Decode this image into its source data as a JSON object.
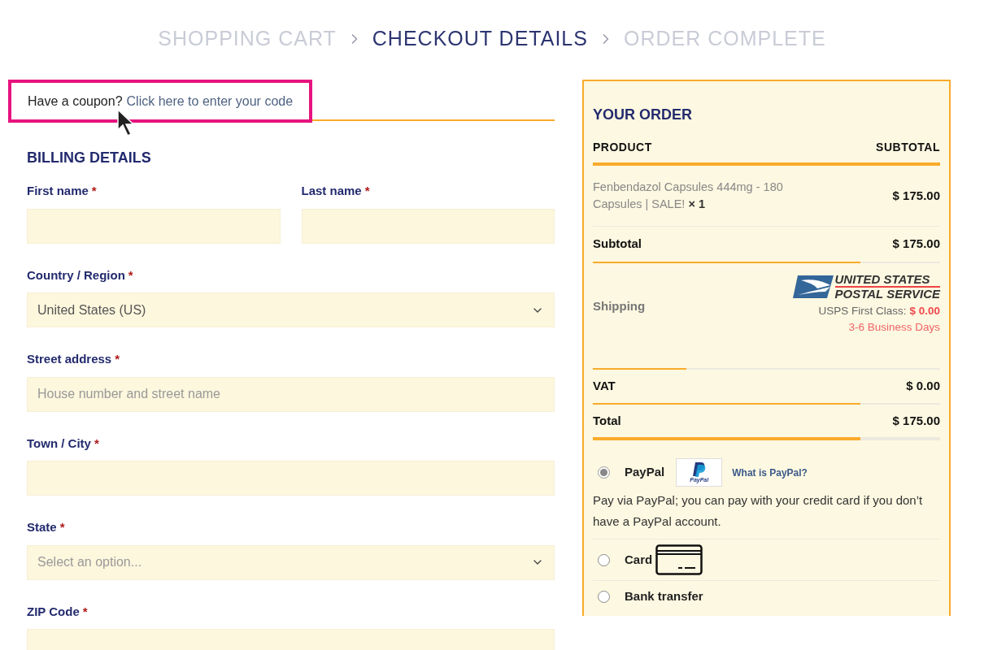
{
  "breadcrumb": [
    {
      "label": "SHOPPING CART",
      "selected": false
    },
    {
      "label": "CHECKOUT DETAILS",
      "selected": true
    },
    {
      "label": "ORDER COMPLETE",
      "selected": false
    }
  ],
  "coupon": {
    "prompt": "Have a coupon?",
    "link": "Click here to enter your code",
    "highlighted": true
  },
  "billing": {
    "title": "BILLING DETAILS",
    "rows": [
      [
        {
          "label": "First name",
          "required_mark": "*",
          "kind": "text"
        },
        {
          "label": "Last name",
          "required_mark": "*",
          "kind": "text"
        }
      ],
      [
        {
          "label": "Country / Region",
          "required_mark": "*",
          "kind": "select",
          "value": "United States (US)"
        }
      ],
      [
        {
          "label": "Street address",
          "required_mark": "*",
          "kind": "text",
          "placeholder": "House number and street name"
        }
      ],
      [
        {
          "label": "Town / City",
          "required_mark": "*",
          "kind": "text"
        }
      ],
      [
        {
          "label": "State",
          "required_mark": "*",
          "kind": "select",
          "placeholder": "Select an option..."
        }
      ],
      [
        {
          "label": "ZIP Code",
          "required_mark": "*",
          "kind": "text"
        }
      ]
    ]
  },
  "order": {
    "title": "YOUR ORDER",
    "columns": [
      "PRODUCT",
      "SUBTOTAL"
    ],
    "items": [
      {
        "name": "Fenbendazol Capsules 444mg - 180 Capsules | SALE!",
        "quantity": "× 1",
        "price": "$ 175.00"
      }
    ],
    "subtotal": {
      "label": "Subtotal",
      "value": "$ 175.00"
    },
    "shipping": {
      "label": "Shipping",
      "logo_text": [
        "UNITED STATES",
        "POSTAL SERVICE"
      ],
      "method": "USPS First Class:",
      "price": "$ 0.00",
      "eta": "3-6 Business Days"
    },
    "vat": {
      "label": "VAT",
      "value": "$ 0.00"
    },
    "total": {
      "label": "Total",
      "value": "$ 175.00"
    }
  },
  "payment_methods": [
    {
      "kind": "paypal",
      "label": "PayPal",
      "selected": true,
      "logo_text": "PayPal",
      "link": "What is PayPal?",
      "description": "Pay via PayPal; you can pay with your credit card if you don’t have a PayPal account."
    },
    {
      "kind": "card",
      "label": "Card",
      "selected": false
    },
    {
      "kind": "bank",
      "label": "Bank transfer",
      "selected": false
    }
  ]
}
